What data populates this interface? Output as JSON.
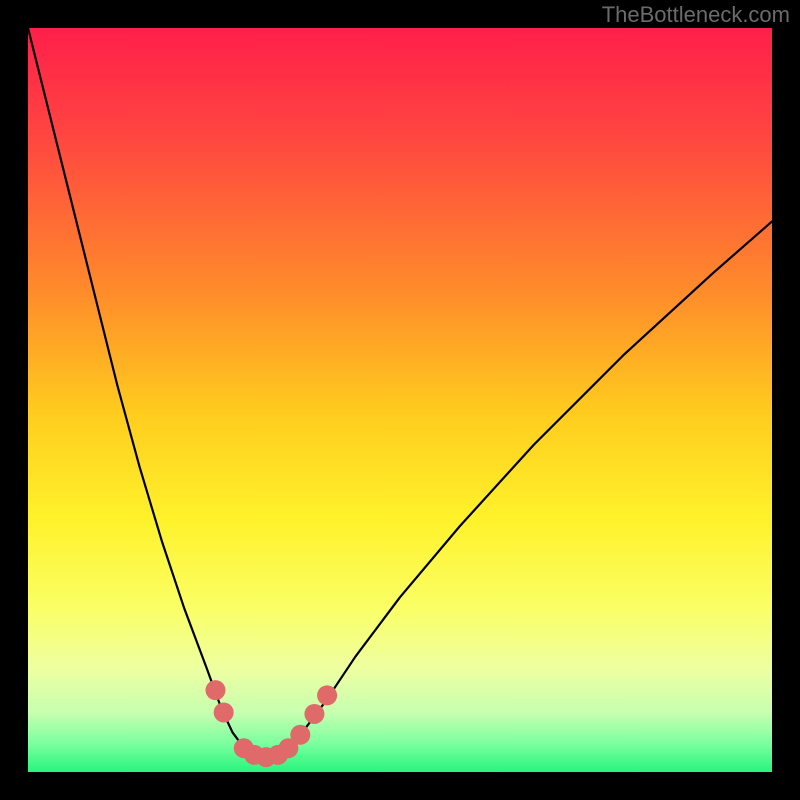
{
  "watermark": "TheBottleneck.com",
  "chart_data": {
    "type": "line",
    "title": "",
    "xlabel": "",
    "ylabel": "",
    "xlim": [
      0,
      100
    ],
    "ylim": [
      0,
      100
    ],
    "grid": false,
    "background_gradient": {
      "stops": [
        {
          "offset": 0.0,
          "color": "#ff1f4a"
        },
        {
          "offset": 0.15,
          "color": "#ff4740"
        },
        {
          "offset": 0.35,
          "color": "#ff8a2b"
        },
        {
          "offset": 0.52,
          "color": "#ffcd1e"
        },
        {
          "offset": 0.66,
          "color": "#fff22b"
        },
        {
          "offset": 0.78,
          "color": "#faff66"
        },
        {
          "offset": 0.86,
          "color": "#eeffa0"
        },
        {
          "offset": 0.92,
          "color": "#c7ffb0"
        },
        {
          "offset": 0.96,
          "color": "#7fffa0"
        },
        {
          "offset": 1.0,
          "color": "#27f57d"
        }
      ]
    },
    "series": [
      {
        "name": "bottleneck-curve",
        "color": "#000000",
        "width": 2.2,
        "x": [
          0,
          3,
          6,
          9,
          12,
          15,
          18,
          21,
          24,
          26,
          27.5,
          29,
          30.5,
          32,
          33.5,
          35,
          37,
          40,
          44,
          50,
          58,
          68,
          80,
          92,
          100
        ],
        "y": [
          100,
          88,
          76,
          64,
          52,
          41,
          31,
          22,
          14,
          8.5,
          5.3,
          3.3,
          2.3,
          2.0,
          2.3,
          3.3,
          5.5,
          9.5,
          15.5,
          23.5,
          33,
          44,
          56,
          67,
          74
        ]
      }
    ],
    "markers": {
      "name": "highlight-dots",
      "color": "#e06a6a",
      "radius": 10,
      "points": [
        {
          "x": 25.2,
          "y": 11.0
        },
        {
          "x": 26.3,
          "y": 8.0
        },
        {
          "x": 29.0,
          "y": 3.2
        },
        {
          "x": 30.4,
          "y": 2.3
        },
        {
          "x": 32.0,
          "y": 2.0
        },
        {
          "x": 33.6,
          "y": 2.3
        },
        {
          "x": 35.0,
          "y": 3.2
        },
        {
          "x": 36.6,
          "y": 5.0
        },
        {
          "x": 38.5,
          "y": 7.8
        },
        {
          "x": 40.2,
          "y": 10.3
        }
      ]
    }
  }
}
